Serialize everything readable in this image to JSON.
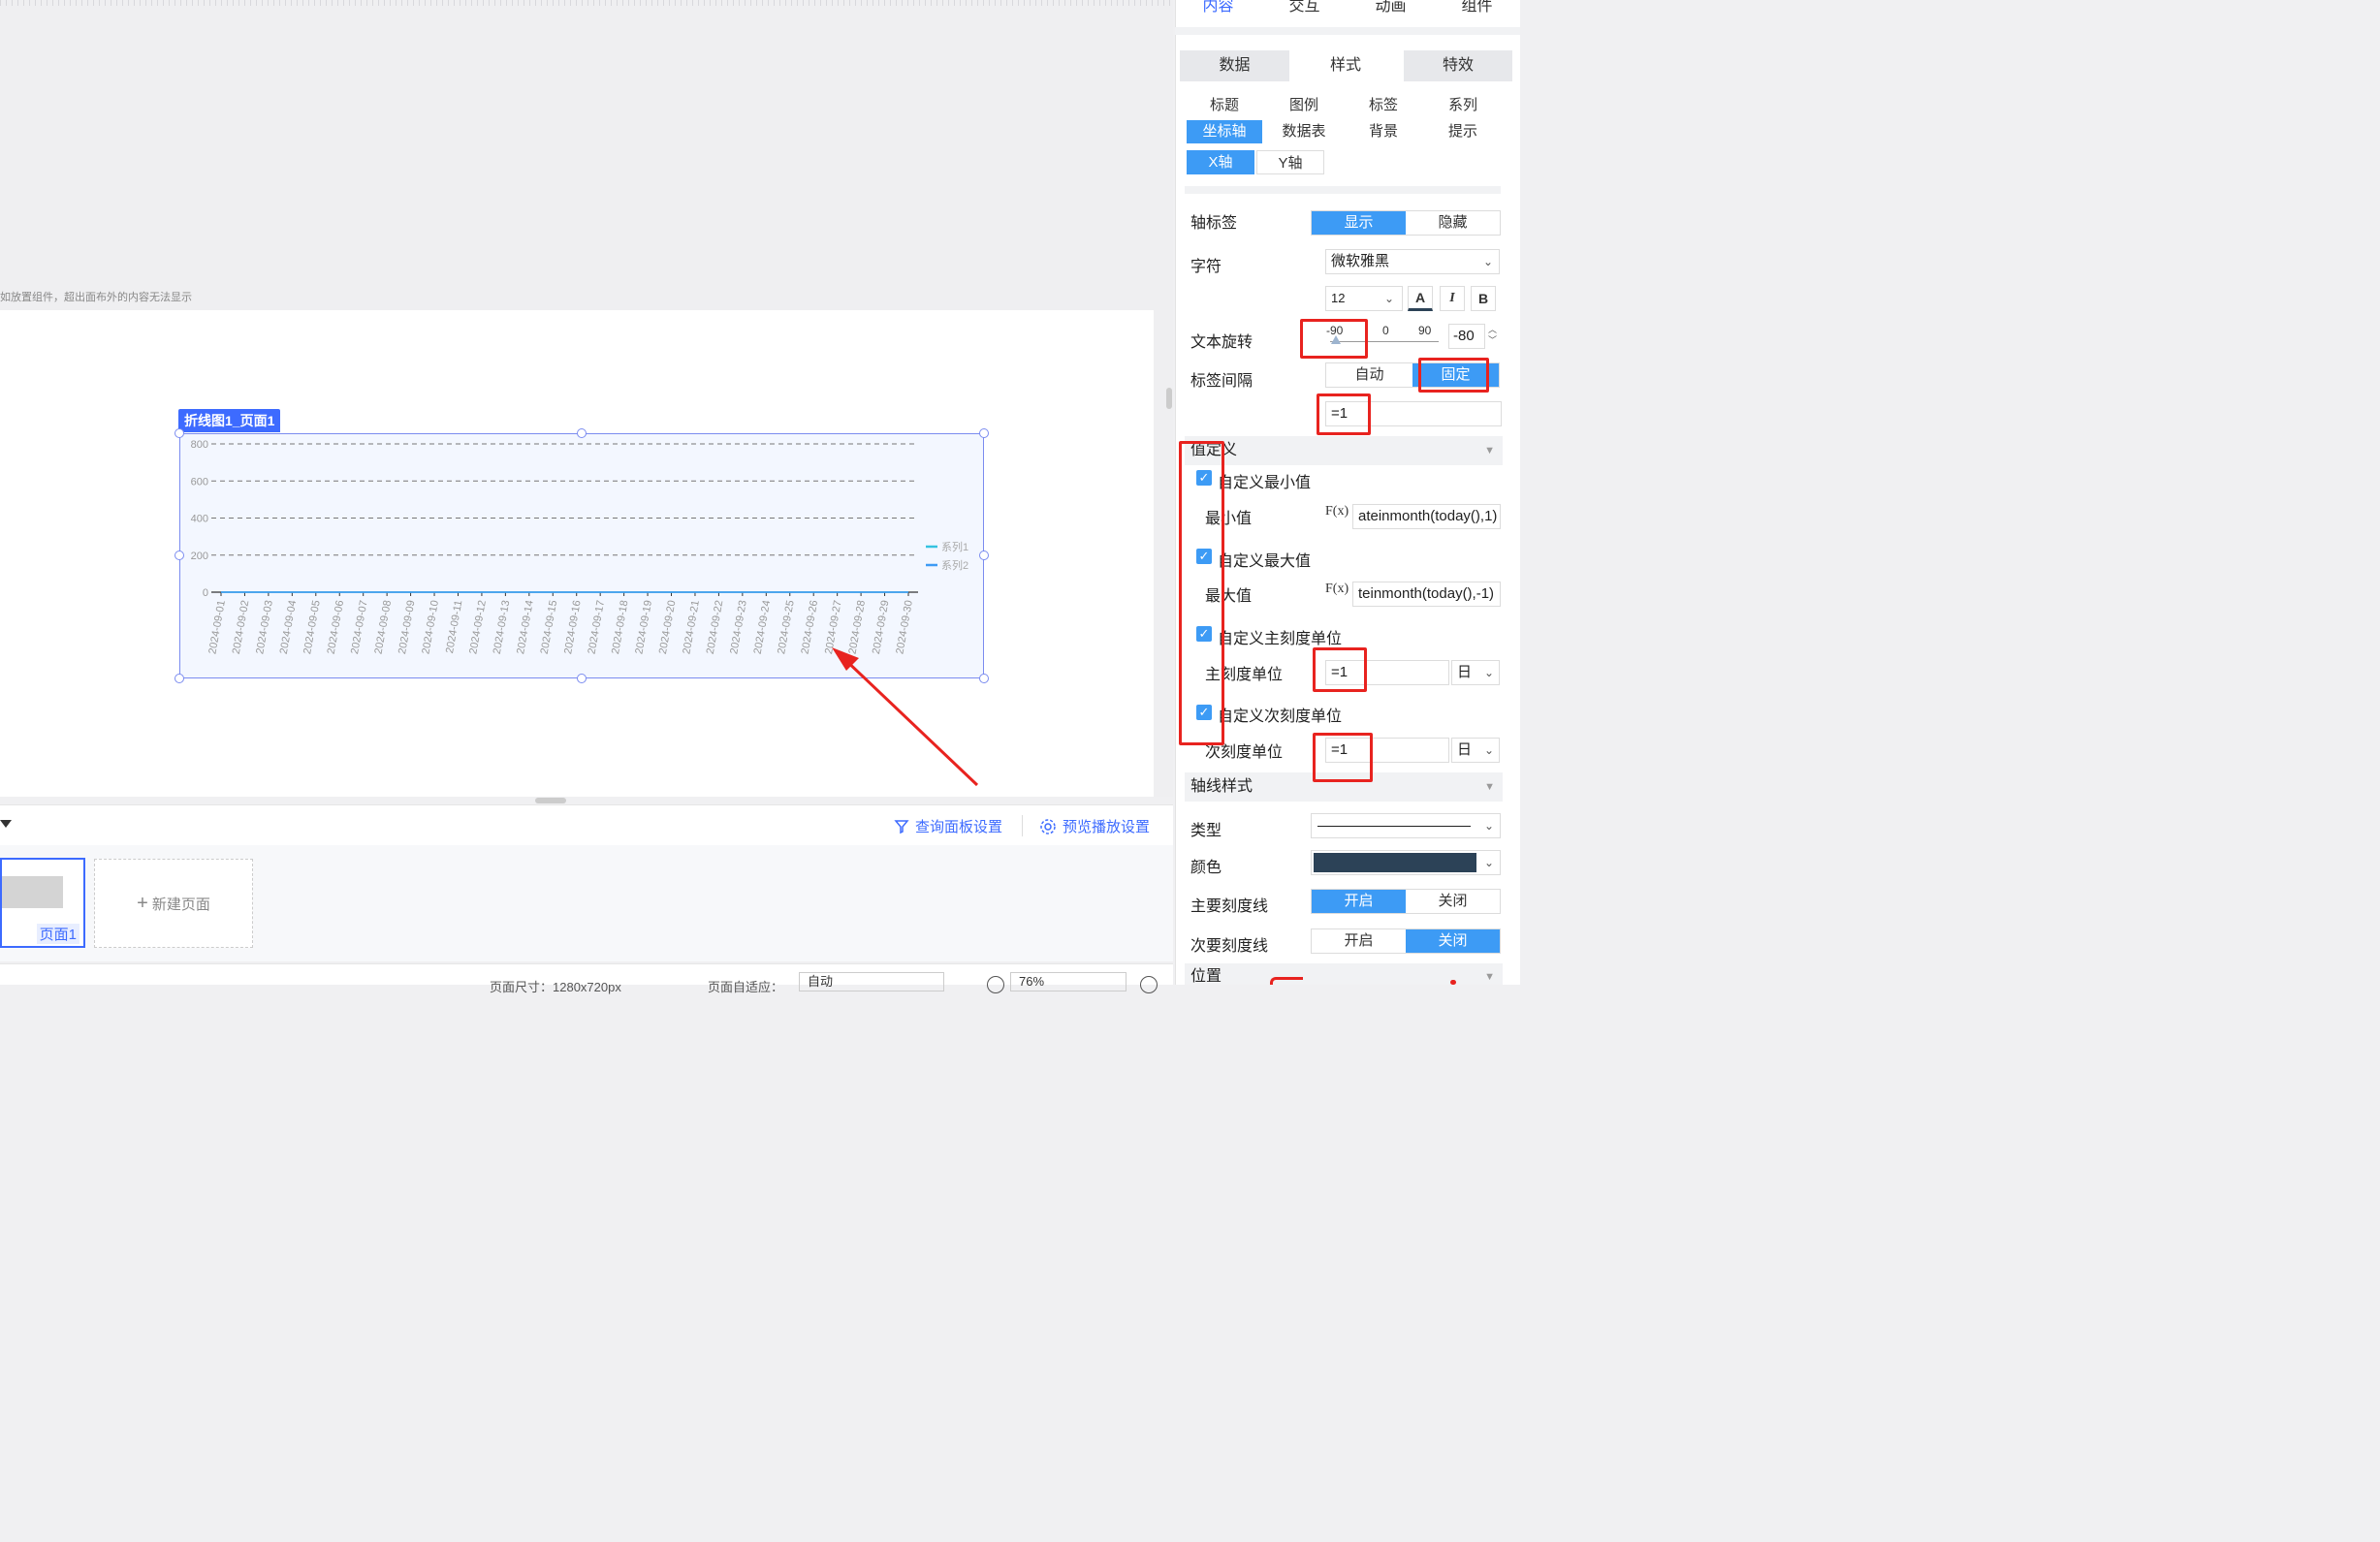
{
  "canvas": {
    "hint": "如放置组件，超出面布外的内容无法显示"
  },
  "chart": {
    "tag": "折线图1_页面1"
  },
  "chart_data": {
    "type": "line",
    "title": "",
    "categories": [
      "2024-09-01",
      "2024-09-02",
      "2024-09-03",
      "2024-09-04",
      "2024-09-05",
      "2024-09-06",
      "2024-09-07",
      "2024-09-08",
      "2024-09-09",
      "2024-09-10",
      "2024-09-11",
      "2024-09-12",
      "2024-09-13",
      "2024-09-14",
      "2024-09-15",
      "2024-09-16",
      "2024-09-17",
      "2024-09-18",
      "2024-09-19",
      "2024-09-20",
      "2024-09-21",
      "2024-09-22",
      "2024-09-23",
      "2024-09-24",
      "2024-09-25",
      "2024-09-26",
      "2024-09-27",
      "2024-09-28",
      "2024-09-29",
      "2024-09-30"
    ],
    "y_ticks": [
      "800",
      "600",
      "400",
      "200",
      "0"
    ],
    "ylim": [
      0,
      800
    ],
    "x_label_rotation": -80,
    "series": [
      {
        "name": "系列1",
        "color": "#35c3e0",
        "values": [
          0,
          0,
          0,
          0,
          0,
          0,
          0,
          0,
          0,
          0,
          0,
          0,
          0,
          0,
          0,
          0,
          0,
          0,
          0,
          0,
          0,
          0,
          0,
          0,
          0,
          0,
          0,
          0,
          0,
          0
        ]
      },
      {
        "name": "系列2",
        "color": "#3d9bf5",
        "values": [
          0,
          0,
          0,
          0,
          0,
          0,
          0,
          0,
          0,
          0,
          0,
          0,
          0,
          0,
          0,
          0,
          0,
          0,
          0,
          0,
          0,
          0,
          0,
          0,
          0,
          0,
          0,
          0,
          0,
          0
        ]
      }
    ],
    "grid": "dashed horizontal",
    "legend_position": "right"
  },
  "bottom": {
    "query_panel": "查询面板设置",
    "preview_settings": "预览播放设置",
    "page1_label": "页面1",
    "new_page": "新建页面",
    "status_size_label": "页面尺寸：1280x720px",
    "status_fit_label": "页面自适应：",
    "status_fit_value": "自动",
    "zoom_value": "76%"
  },
  "rpanel": {
    "top_tabs": [
      "内容",
      "交互",
      "动画",
      "组件"
    ],
    "sub_tabs": [
      "数据",
      "样式",
      "特效"
    ],
    "mini_tabs": [
      "标题",
      "图例",
      "标签",
      "系列",
      "坐标轴",
      "数据表",
      "背景",
      "提示"
    ],
    "axis_tabs": [
      "X轴",
      "Y轴"
    ],
    "axis_label": "轴标签",
    "show": "显示",
    "hide": "隐藏",
    "font_label": "字符",
    "font_value": "微软雅黑",
    "font_size": "12",
    "text_rotate": "文本旋转",
    "rotate_marks": [
      "-90",
      "0",
      "90"
    ],
    "rotate_value": "-80",
    "label_interval": "标签间隔",
    "auto": "自动",
    "fixed": "固定",
    "interval_value": "=1",
    "custom_section": "值定义",
    "custom_min": "自定义最小值",
    "min_label": "最小值",
    "min_formula": "ateinmonth(today(),1)",
    "custom_max": "自定义最大值",
    "max_label": "最大值",
    "max_formula": "teinmonth(today(),-1)",
    "custom_major": "自定义主刻度单位",
    "major_label": "主刻度单位",
    "major_value": "=1",
    "major_unit": "日",
    "custom_minor": "自定义次刻度单位",
    "minor_label": "次刻度单位",
    "minor_value": "=1",
    "minor_unit": "日",
    "axis_style": "轴线样式",
    "type_label": "类型",
    "color_label": "颜色",
    "axis_color": "#2c4257",
    "major_tick": "主要刻度线",
    "minor_tick": "次要刻度线",
    "on": "开启",
    "off": "关闭",
    "position": "位置",
    "fx": "F(x)",
    "bold": "B",
    "italic": "I",
    "color_a": "A"
  },
  "colors": {
    "accent": "#3d6bff",
    "tab_active": "#3d9bf5",
    "annotation_red": "#e8231f"
  }
}
